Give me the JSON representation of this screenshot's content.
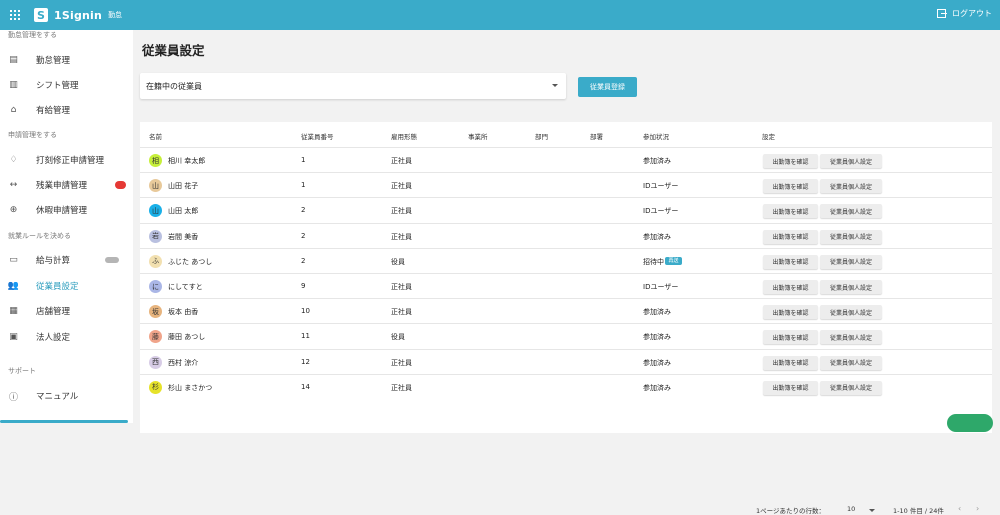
{
  "header": {
    "app_name": "1Signin",
    "badge": "勤怠",
    "logout_label": "ログアウト",
    "brand_color": "#3aabc9"
  },
  "sidebar": {
    "sections": [
      {
        "label": "勤怠管理をする"
      },
      {
        "label": "申請管理をする"
      },
      {
        "label": "就業ルールを決める"
      },
      {
        "label": "サポート"
      }
    ],
    "items": [
      {
        "label": "勤怠管理",
        "icon": "list-icon"
      },
      {
        "label": "シフト管理",
        "icon": "columns-icon"
      },
      {
        "label": "有給管理",
        "icon": "home-icon"
      },
      {
        "label": "打刻修正申請管理",
        "icon": "bell-icon"
      },
      {
        "label": "残業申請管理",
        "icon": "arrows-icon"
      },
      {
        "label": "休暇申請管理",
        "icon": "plus-circle-icon"
      },
      {
        "label": "給与計算",
        "icon": "money-icon"
      },
      {
        "label": "従業員設定",
        "icon": "people-icon"
      },
      {
        "label": "店舗管理",
        "icon": "store-icon"
      },
      {
        "label": "法人設定",
        "icon": "building-icon"
      },
      {
        "label": "マニュアル",
        "icon": "help-icon"
      }
    ]
  },
  "main": {
    "title": "従業員設定",
    "filter_select": {
      "value": "在籍中の従業員"
    },
    "register_button": "従業員登録",
    "columns": [
      "名前",
      "従業員番号",
      "雇用形態",
      "事業所",
      "部門",
      "部署",
      "参加状況",
      "設定"
    ],
    "row_button_1": "出勤簿を確認",
    "row_button_2": "従業員個人設定",
    "rows": [
      {
        "initial": "相",
        "avatar_color": "#c6ef3a",
        "name": "相川 幸太郎",
        "number": "1",
        "employment": "正社員",
        "status": "参加済み",
        "badge": ""
      },
      {
        "initial": "山",
        "avatar_color": "#e8c99a",
        "name": "山田 花子",
        "number": "1",
        "employment": "正社員",
        "status": "IDユーザー",
        "badge": ""
      },
      {
        "initial": "山",
        "avatar_color": "#1ab0e8",
        "name": "山田 太郎",
        "number": "2",
        "employment": "正社員",
        "status": "IDユーザー",
        "badge": ""
      },
      {
        "initial": "岩",
        "avatar_color": "#b9c0e0",
        "name": "岩間 美香",
        "number": "2",
        "employment": "正社員",
        "status": "参加済み",
        "badge": ""
      },
      {
        "initial": "ふ",
        "avatar_color": "#f2e0b0",
        "name": "ふじた あつし",
        "number": "2",
        "employment": "役員",
        "status": "招待中",
        "badge": "再送"
      },
      {
        "initial": "に",
        "avatar_color": "#aab6e6",
        "name": "にしてすと",
        "number": "9",
        "employment": "正社員",
        "status": "IDユーザー",
        "badge": ""
      },
      {
        "initial": "坂",
        "avatar_color": "#e7b47e",
        "name": "坂本 由香",
        "number": "10",
        "employment": "正社員",
        "status": "参加済み",
        "badge": ""
      },
      {
        "initial": "藤",
        "avatar_color": "#f0a48a",
        "name": "藤田 あつし",
        "number": "11",
        "employment": "役員",
        "status": "参加済み",
        "badge": ""
      },
      {
        "initial": "西",
        "avatar_color": "#d7cce6",
        "name": "西村 涼介",
        "number": "12",
        "employment": "正社員",
        "status": "参加済み",
        "badge": ""
      },
      {
        "initial": "杉",
        "avatar_color": "#e6e22a",
        "name": "杉山 まさかつ",
        "number": "14",
        "employment": "正社員",
        "status": "参加済み",
        "badge": ""
      }
    ],
    "pagination": {
      "rows_per_page_label": "1ページあたりの行数：",
      "rows_per_page": "10",
      "range": "1-10 件目 / 24件"
    }
  }
}
